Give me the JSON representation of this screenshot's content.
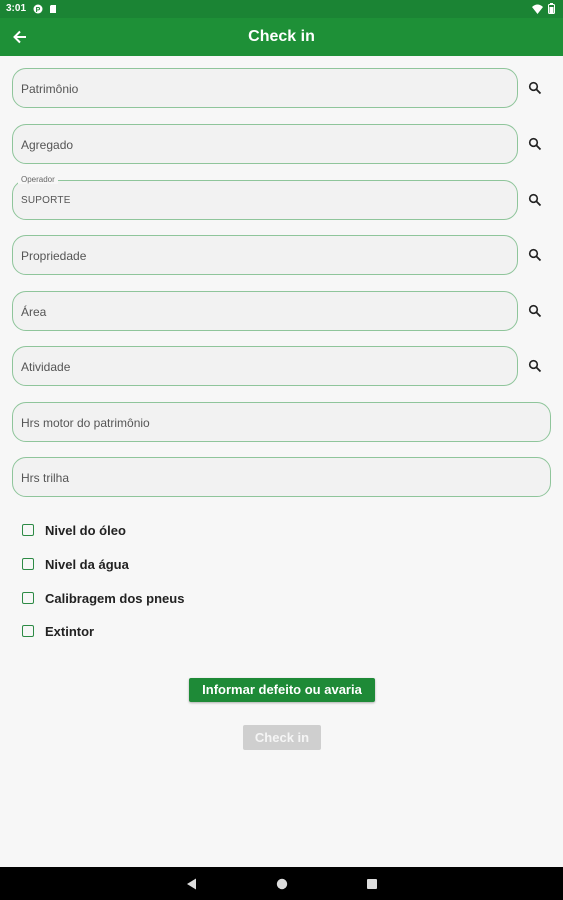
{
  "status_bar": {
    "time": "3:01"
  },
  "app_bar": {
    "title": "Check in"
  },
  "form": {
    "patrimonio": {
      "placeholder": "Patrimônio"
    },
    "agregado": {
      "placeholder": "Agregado"
    },
    "operador": {
      "label": "Operador",
      "value": "SUPORTE"
    },
    "propriedade": {
      "placeholder": "Propriedade"
    },
    "area": {
      "placeholder": "Área"
    },
    "atividade": {
      "placeholder": "Atividade"
    },
    "hrs_motor": {
      "placeholder": "Hrs motor do patrimônio"
    },
    "hrs_trilha": {
      "placeholder": "Hrs trilha"
    }
  },
  "checklist": [
    {
      "label": "Nivel do óleo",
      "checked": false
    },
    {
      "label": "Nivel da água",
      "checked": false
    },
    {
      "label": "Calibragem dos pneus",
      "checked": false
    },
    {
      "label": "Extintor",
      "checked": false
    }
  ],
  "buttons": {
    "report_defect": "Informar defeito ou avaria",
    "check_in": "Check in"
  },
  "colors": {
    "primary": "#1e9037",
    "status_bar": "#1b8434",
    "field_border": "#8fc59b",
    "disabled_button": "#cfcfcf"
  },
  "icons": [
    "back-arrow-icon",
    "search-icon",
    "wifi-icon",
    "battery-icon",
    "back-nav-icon",
    "home-nav-icon",
    "recents-nav-icon"
  ]
}
